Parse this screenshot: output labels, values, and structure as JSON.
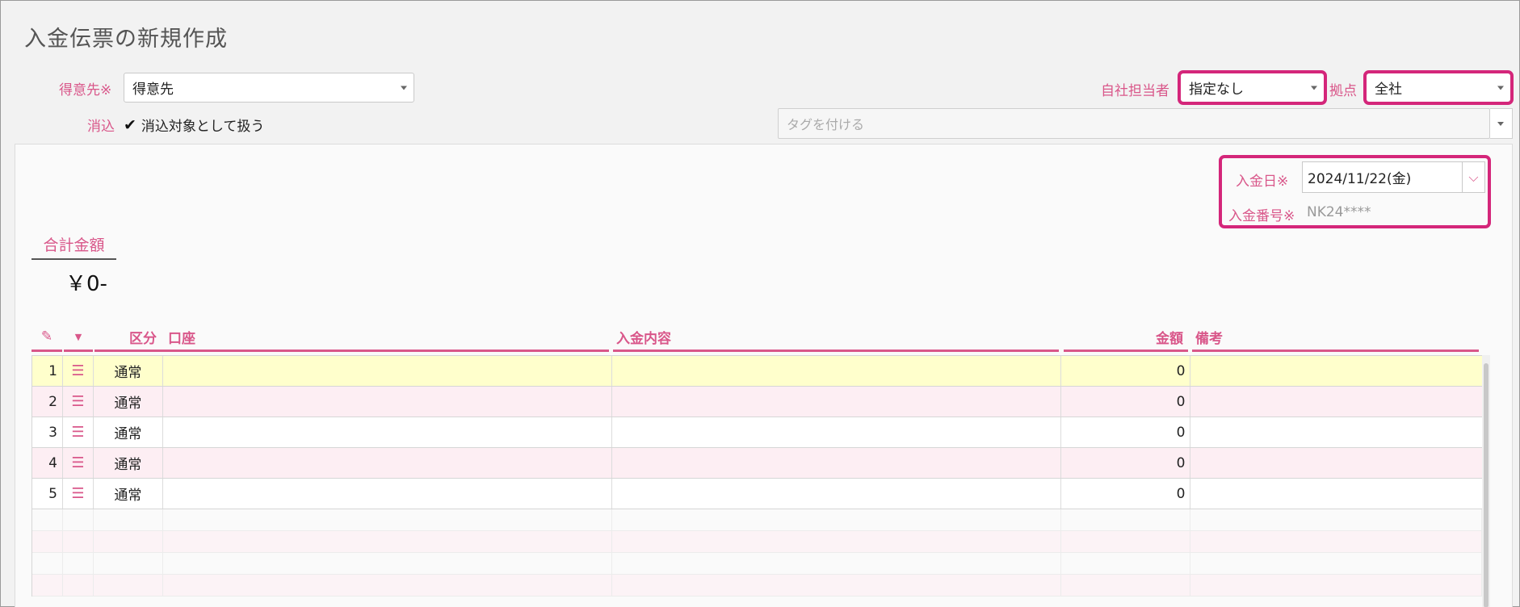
{
  "page": {
    "title": "入金伝票の新規作成"
  },
  "form": {
    "customer_label": "得意先※",
    "customer_value": "得意先",
    "offset_label": "消込",
    "offset_checkbox_label": "消込対象として扱う",
    "offset_checked": true,
    "staff_label": "自社担当者",
    "staff_value": "指定なし",
    "base_label": "拠点",
    "base_value": "全社",
    "tag_placeholder": "タグを付ける"
  },
  "voucher": {
    "date_label": "入金日※",
    "date_value": "2024/11/22(金)",
    "number_label": "入金番号※",
    "number_value": "NK24****"
  },
  "total": {
    "label": "合計金額",
    "value": "￥0-"
  },
  "table": {
    "headers": {
      "kubun": "区分",
      "kouza": "口座",
      "naiyou": "入金内容",
      "kingaku": "金額",
      "bikou": "備考"
    },
    "rows": [
      {
        "no": "1",
        "kubun": "通常",
        "kouza": "",
        "naiyou": "",
        "kingaku": "0",
        "bikou": ""
      },
      {
        "no": "2",
        "kubun": "通常",
        "kouza": "",
        "naiyou": "",
        "kingaku": "0",
        "bikou": ""
      },
      {
        "no": "3",
        "kubun": "通常",
        "kouza": "",
        "naiyou": "",
        "kingaku": "0",
        "bikou": ""
      },
      {
        "no": "4",
        "kubun": "通常",
        "kouza": "",
        "naiyou": "",
        "kingaku": "0",
        "bikou": ""
      },
      {
        "no": "5",
        "kubun": "通常",
        "kouza": "",
        "naiyou": "",
        "kingaku": "0",
        "bikou": ""
      }
    ]
  },
  "colors": {
    "accent": "#d9578a",
    "highlight": "#d4267a",
    "row_selected": "#ffffcc",
    "row_alt": "#fdeef3"
  }
}
